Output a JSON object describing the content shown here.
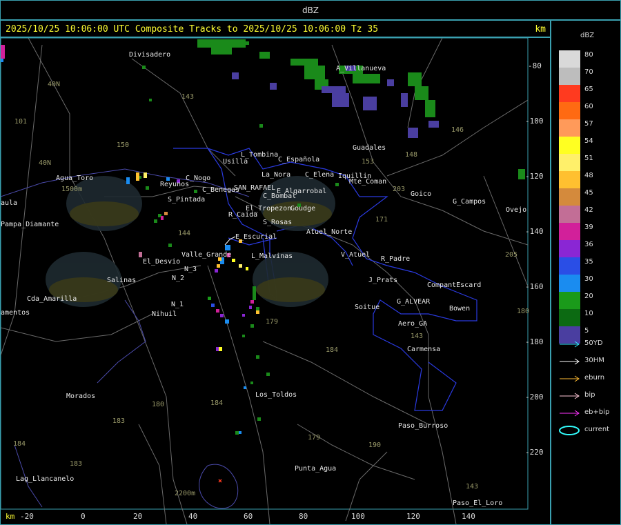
{
  "window": {
    "title": "dBZ"
  },
  "header": {
    "title": "2025/10/25 10:06:00 UTC Composite Tracks to 2025/10/25 10:06:00 Tz 35",
    "unit": "km"
  },
  "axis": {
    "x_unit": "km",
    "x_ticks": [
      "-20",
      "0",
      "20",
      "40",
      "60",
      "80",
      "100",
      "120",
      "140"
    ],
    "y_ticks": [
      "-80",
      "-100",
      "-120",
      "-140",
      "-160",
      "-180",
      "-200",
      "-220"
    ]
  },
  "legend": {
    "title": "dBZ",
    "levels": [
      {
        "label": "80",
        "color": "#d9d9d9"
      },
      {
        "label": "70",
        "color": "#bdbdbd"
      },
      {
        "label": "65",
        "color": "#ff3a1f"
      },
      {
        "label": "60",
        "color": "#ff6a12"
      },
      {
        "label": "57",
        "color": "#ff9a5a"
      },
      {
        "label": "54",
        "color": "#ffff22"
      },
      {
        "label": "51",
        "color": "#fff06a"
      },
      {
        "label": "48",
        "color": "#ffc030"
      },
      {
        "label": "45",
        "color": "#d48a3c"
      },
      {
        "label": "42",
        "color": "#c26e96"
      },
      {
        "label": "39",
        "color": "#d2209a"
      },
      {
        "label": "36",
        "color": "#8a26d4"
      },
      {
        "label": "35",
        "color": "#2a4ee6"
      },
      {
        "label": "30",
        "color": "#1a8cf0"
      },
      {
        "label": "20",
        "color": "#1a9a1a"
      },
      {
        "label": "10",
        "color": "#0c6a12"
      },
      {
        "label": "5",
        "color": "#4a3ea0"
      }
    ],
    "tracks": [
      {
        "label": "50YD",
        "color": "#33e6ff"
      },
      {
        "label": "30HM",
        "color": "#ffffff"
      },
      {
        "label": "eburn",
        "color": "#ffbb33"
      },
      {
        "label": "bip",
        "color": "#ffc8d8"
      },
      {
        "label": "eb+bip",
        "color": "#ff33ff"
      },
      {
        "label": "current",
        "color": "#33ffff"
      }
    ]
  },
  "places": [
    {
      "name": "Divisadero"
    },
    {
      "name": "40N"
    },
    {
      "name": "101"
    },
    {
      "name": "40N"
    },
    {
      "name": "Agua_Toro"
    },
    {
      "name": "1500m"
    },
    {
      "name": "aula"
    },
    {
      "name": "Pampa_Diamante"
    },
    {
      "name": "El_Desvio"
    },
    {
      "name": "Salinas"
    },
    {
      "name": "Cda_Amarilla"
    },
    {
      "name": "amentos"
    },
    {
      "name": "Morados"
    },
    {
      "name": "184"
    },
    {
      "name": "183"
    },
    {
      "name": "Lag_Llancanelo"
    },
    {
      "name": "Reyunos"
    },
    {
      "name": "C_Nogo"
    },
    {
      "name": "S_Pintada"
    },
    {
      "name": "Usilla"
    },
    {
      "name": "L_Tombina"
    },
    {
      "name": "C_Española"
    },
    {
      "name": "La_Nora"
    },
    {
      "name": "C_Benegas"
    },
    {
      "name": "SAN_RAFAEL"
    },
    {
      "name": "E_Algarrobal"
    },
    {
      "name": "C_Bombal"
    },
    {
      "name": "C_Elena"
    },
    {
      "name": "Iquillin"
    },
    {
      "name": "Mte_Coman"
    },
    {
      "name": "R_Caida"
    },
    {
      "name": "El_Tropezon"
    },
    {
      "name": "Goudge"
    },
    {
      "name": "S_Rosas"
    },
    {
      "name": "Atuel_Norte"
    },
    {
      "name": "E_Escurial"
    },
    {
      "name": "Valle_Grande"
    },
    {
      "name": "L_Malvinas"
    },
    {
      "name": "N_2"
    },
    {
      "name": "N_3"
    },
    {
      "name": "N_1"
    },
    {
      "name": "Nihuil"
    },
    {
      "name": "V_Atuel"
    },
    {
      "name": "R_Padre"
    },
    {
      "name": "J_Prats"
    },
    {
      "name": "CompantEscard"
    },
    {
      "name": "G_ALVEAR"
    },
    {
      "name": "Soitue"
    },
    {
      "name": "Bowen"
    },
    {
      "name": "Aero_GA"
    },
    {
      "name": "Carmensa"
    },
    {
      "name": "Guadales"
    },
    {
      "name": "Goico"
    },
    {
      "name": "G_Campos"
    },
    {
      "name": "Ovejo"
    },
    {
      "name": "A_Villanueva"
    },
    {
      "name": "Los_Toldos"
    },
    {
      "name": "Paso_Burroso"
    },
    {
      "name": "Punta_Agua"
    },
    {
      "name": "Paso_El_Loro"
    },
    {
      "name": "2200m"
    },
    {
      "name": "143"
    },
    {
      "name": "150"
    },
    {
      "name": "146"
    },
    {
      "name": "153"
    },
    {
      "name": "148"
    },
    {
      "name": "203"
    },
    {
      "name": "171"
    },
    {
      "name": "144"
    },
    {
      "name": "179"
    },
    {
      "name": "184"
    },
    {
      "name": "180"
    },
    {
      "name": "184"
    },
    {
      "name": "179"
    },
    {
      "name": "190"
    },
    {
      "name": "143"
    },
    {
      "name": "205"
    },
    {
      "name": "180"
    },
    {
      "name": "143"
    },
    {
      "name": "183"
    }
  ]
}
